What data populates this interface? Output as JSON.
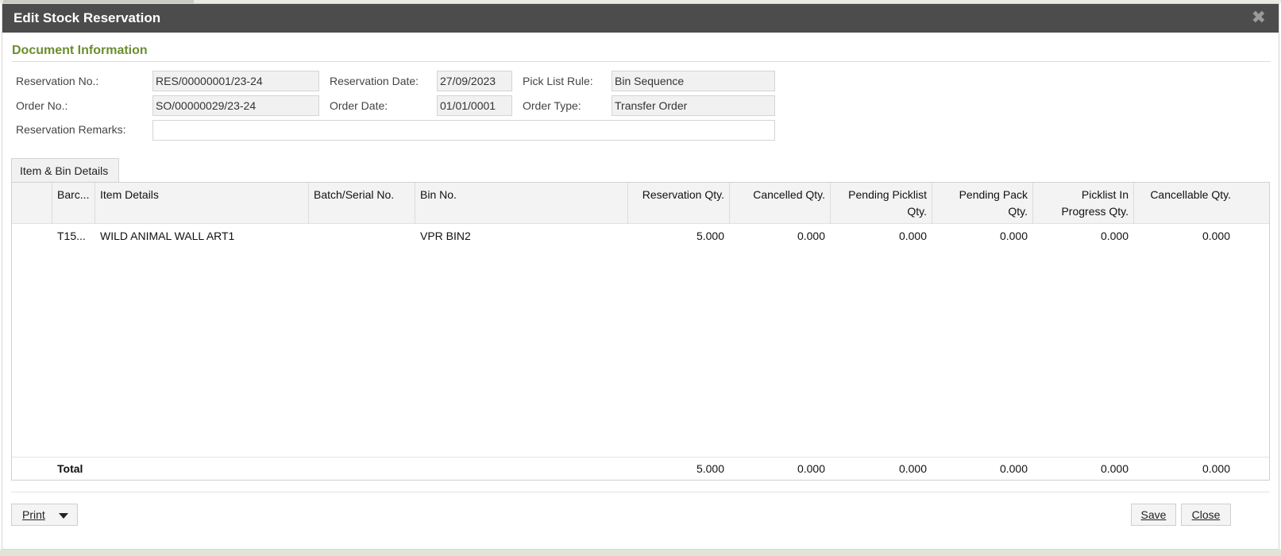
{
  "window": {
    "title": "Edit Stock Reservation",
    "close_glyph": "✖"
  },
  "section": {
    "title": "Document Information"
  },
  "form": {
    "reservation_no": {
      "label": "Reservation No.:",
      "value": "RES/00000001/23-24"
    },
    "reservation_date": {
      "label": "Reservation Date:",
      "value": "27/09/2023"
    },
    "pick_list_rule": {
      "label": "Pick List Rule:",
      "value": "Bin Sequence"
    },
    "order_no": {
      "label": "Order No.:",
      "value": "SO/00000029/23-24"
    },
    "order_date": {
      "label": "Order Date:",
      "value": "01/01/0001"
    },
    "order_type": {
      "label": "Order Type:",
      "value": "Transfer Order"
    },
    "reservation_remarks": {
      "label": "Reservation Remarks:",
      "value": ""
    }
  },
  "tabs": [
    {
      "label": "Item & Bin Details"
    }
  ],
  "grid": {
    "columns": [
      {
        "label": ""
      },
      {
        "label": "Barc..."
      },
      {
        "label": "Item Details"
      },
      {
        "label": "Batch/Serial No."
      },
      {
        "label": "Bin No."
      },
      {
        "label": "Reservation Qty."
      },
      {
        "label": "Cancelled Qty."
      },
      {
        "label": "Pending Picklist Qty."
      },
      {
        "label": "Pending Pack Qty."
      },
      {
        "label": "Picklist In Progress Qty."
      },
      {
        "label": "Cancellable Qty."
      }
    ],
    "rows": [
      {
        "barcode": "T15...",
        "item_details": "WILD ANIMAL WALL ART1",
        "batch_serial": "",
        "bin_no": "VPR BIN2",
        "reservation_qty": "5.000",
        "cancelled_qty": "0.000",
        "pending_picklist_qty": "0.000",
        "pending_pack_qty": "0.000",
        "picklist_in_progress_qty": "0.000",
        "cancellable_qty": "0.000"
      }
    ],
    "totals": {
      "label": "Total",
      "reservation_qty": "5.000",
      "cancelled_qty": "0.000",
      "pending_picklist_qty": "0.000",
      "pending_pack_qty": "0.000",
      "picklist_in_progress_qty": "0.000",
      "cancellable_qty": "0.000"
    }
  },
  "footer": {
    "print_label": "Print",
    "save_label": "Save",
    "close_label": "Close"
  }
}
